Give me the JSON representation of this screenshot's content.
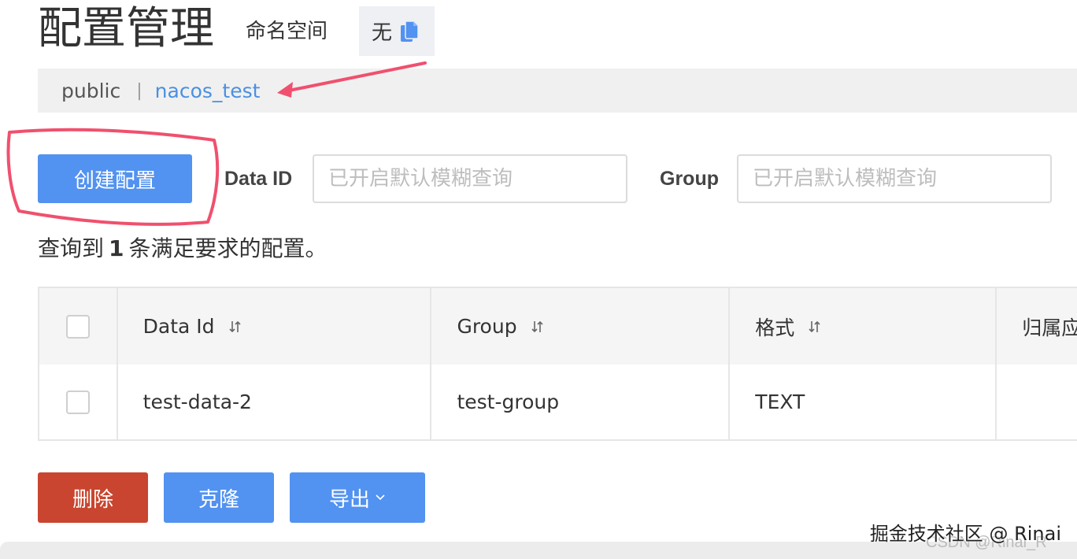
{
  "header": {
    "title": "配置管理",
    "namespace_label": "命名空间",
    "namespace_value": "无",
    "copy_icon": "copy-icon"
  },
  "namespace_bar": {
    "items": [
      "public",
      "nacos_test"
    ],
    "separator": "|",
    "active": "nacos_test"
  },
  "toolbar": {
    "create_label": "创建配置",
    "data_id_label": "Data ID",
    "data_id_placeholder": "已开启默认模糊查询",
    "group_label": "Group",
    "group_placeholder": "已开启默认模糊查询"
  },
  "result": {
    "prefix": "查询到",
    "count": "1",
    "suffix": "条满足要求的配置。"
  },
  "table": {
    "columns": [
      "Data Id",
      "Group",
      "格式",
      "归属应"
    ],
    "rows": [
      {
        "data_id": "test-data-2",
        "group": "test-group",
        "format": "TEXT",
        "app": ""
      }
    ]
  },
  "actions": {
    "delete_label": "删除",
    "clone_label": "克隆",
    "export_label": "导出"
  },
  "watermark": {
    "text": "掘金技术社区 @ Rinai",
    "text2": "CSDN @Rinai_R"
  },
  "colors": {
    "primary": "#5292f0",
    "danger": "#c9452f",
    "link": "#4a90e2",
    "annotation": "#f0506e"
  }
}
